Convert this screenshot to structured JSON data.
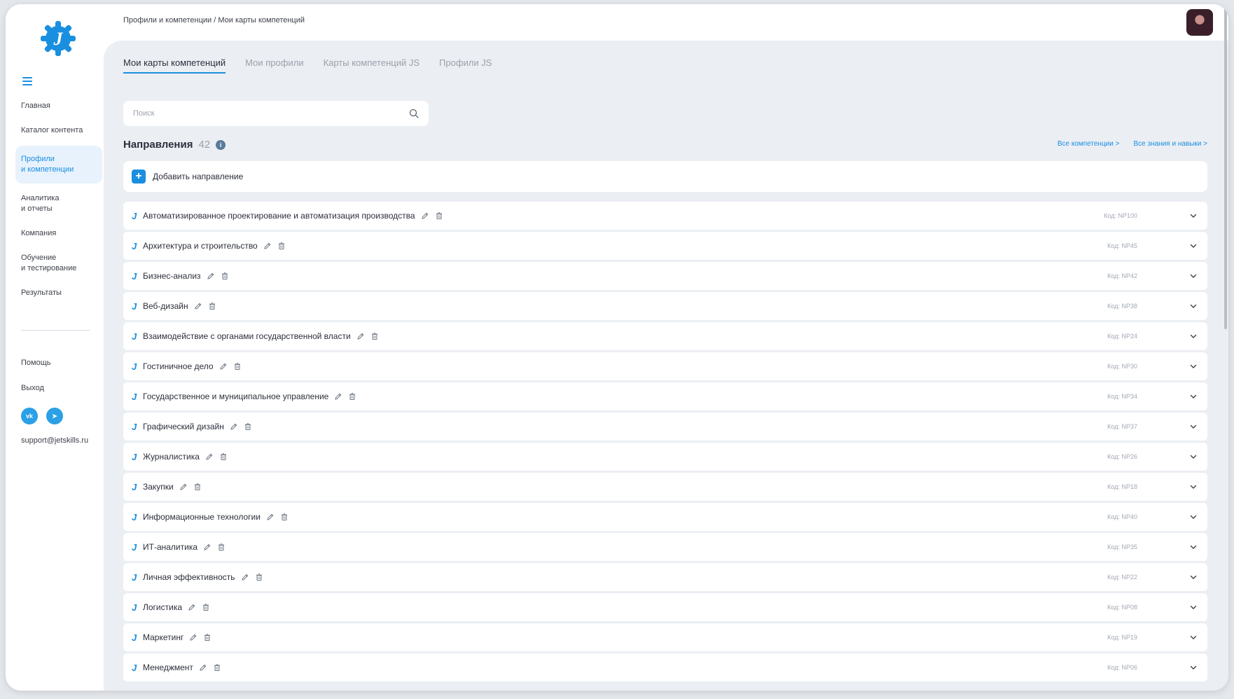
{
  "breadcrumb": "Профили и компетенции / Мои карты компетенций",
  "sidebar": {
    "items": [
      {
        "label": "Главная",
        "active": false
      },
      {
        "label": "Каталог контента",
        "active": false
      },
      {
        "label": "Профили\nи компетенции",
        "active": true
      },
      {
        "label": "Аналитика\nи отчеты",
        "active": false
      },
      {
        "label": "Компания",
        "active": false
      },
      {
        "label": "Обучение\nи тестирование",
        "active": false
      },
      {
        "label": "Результаты",
        "active": false
      }
    ],
    "help": "Помощь",
    "exit": "Выход",
    "social": {
      "vk": "vk",
      "telegram": "➤"
    },
    "email": "support@jetskills.ru"
  },
  "tabs": [
    {
      "label": "Мои карты компетенций",
      "active": true
    },
    {
      "label": "Мои профили",
      "active": false
    },
    {
      "label": "Карты компетенций JS",
      "active": false
    },
    {
      "label": "Профили JS",
      "active": false
    }
  ],
  "search": {
    "placeholder": "Поиск",
    "value": ""
  },
  "section": {
    "title": "Направления",
    "count": "42",
    "info": "i"
  },
  "links": {
    "all_competencies": "Все компетенции >",
    "all_skills": "Все знания и навыки >"
  },
  "add": {
    "label": "Добавить направление",
    "icon": "+"
  },
  "directions": [
    {
      "name": "Автоматизированное проектирование и автоматизация производства",
      "code": "Код: NP100"
    },
    {
      "name": "Архитектура и строительство",
      "code": "Код: NP45"
    },
    {
      "name": "Бизнес-анализ",
      "code": "Код: NP42"
    },
    {
      "name": "Веб-дизайн",
      "code": "Код: NP38"
    },
    {
      "name": "Взаимодействие с органами государственной власти",
      "code": "Код: NP24"
    },
    {
      "name": "Гостиничное дело",
      "code": "Код: NP30"
    },
    {
      "name": "Государственное и муниципальное управление",
      "code": "Код: NP34"
    },
    {
      "name": "Графический дизайн",
      "code": "Код: NP37"
    },
    {
      "name": "Журналистика",
      "code": "Код: NP26"
    },
    {
      "name": "Закупки",
      "code": "Код: NP18"
    },
    {
      "name": "Информационные технологии",
      "code": "Код: NP40"
    },
    {
      "name": "ИТ-аналитика",
      "code": "Код: NP35"
    },
    {
      "name": "Личная эффективность",
      "code": "Код: NP22"
    },
    {
      "name": "Логистика",
      "code": "Код: NP08"
    },
    {
      "name": "Маркетинг",
      "code": "Код: NP19"
    },
    {
      "name": "Менеджмент",
      "code": "Код: NP06"
    }
  ],
  "row_marker": "J",
  "colors": {
    "accent": "#1a8fe0",
    "background": "#ebeef3"
  }
}
